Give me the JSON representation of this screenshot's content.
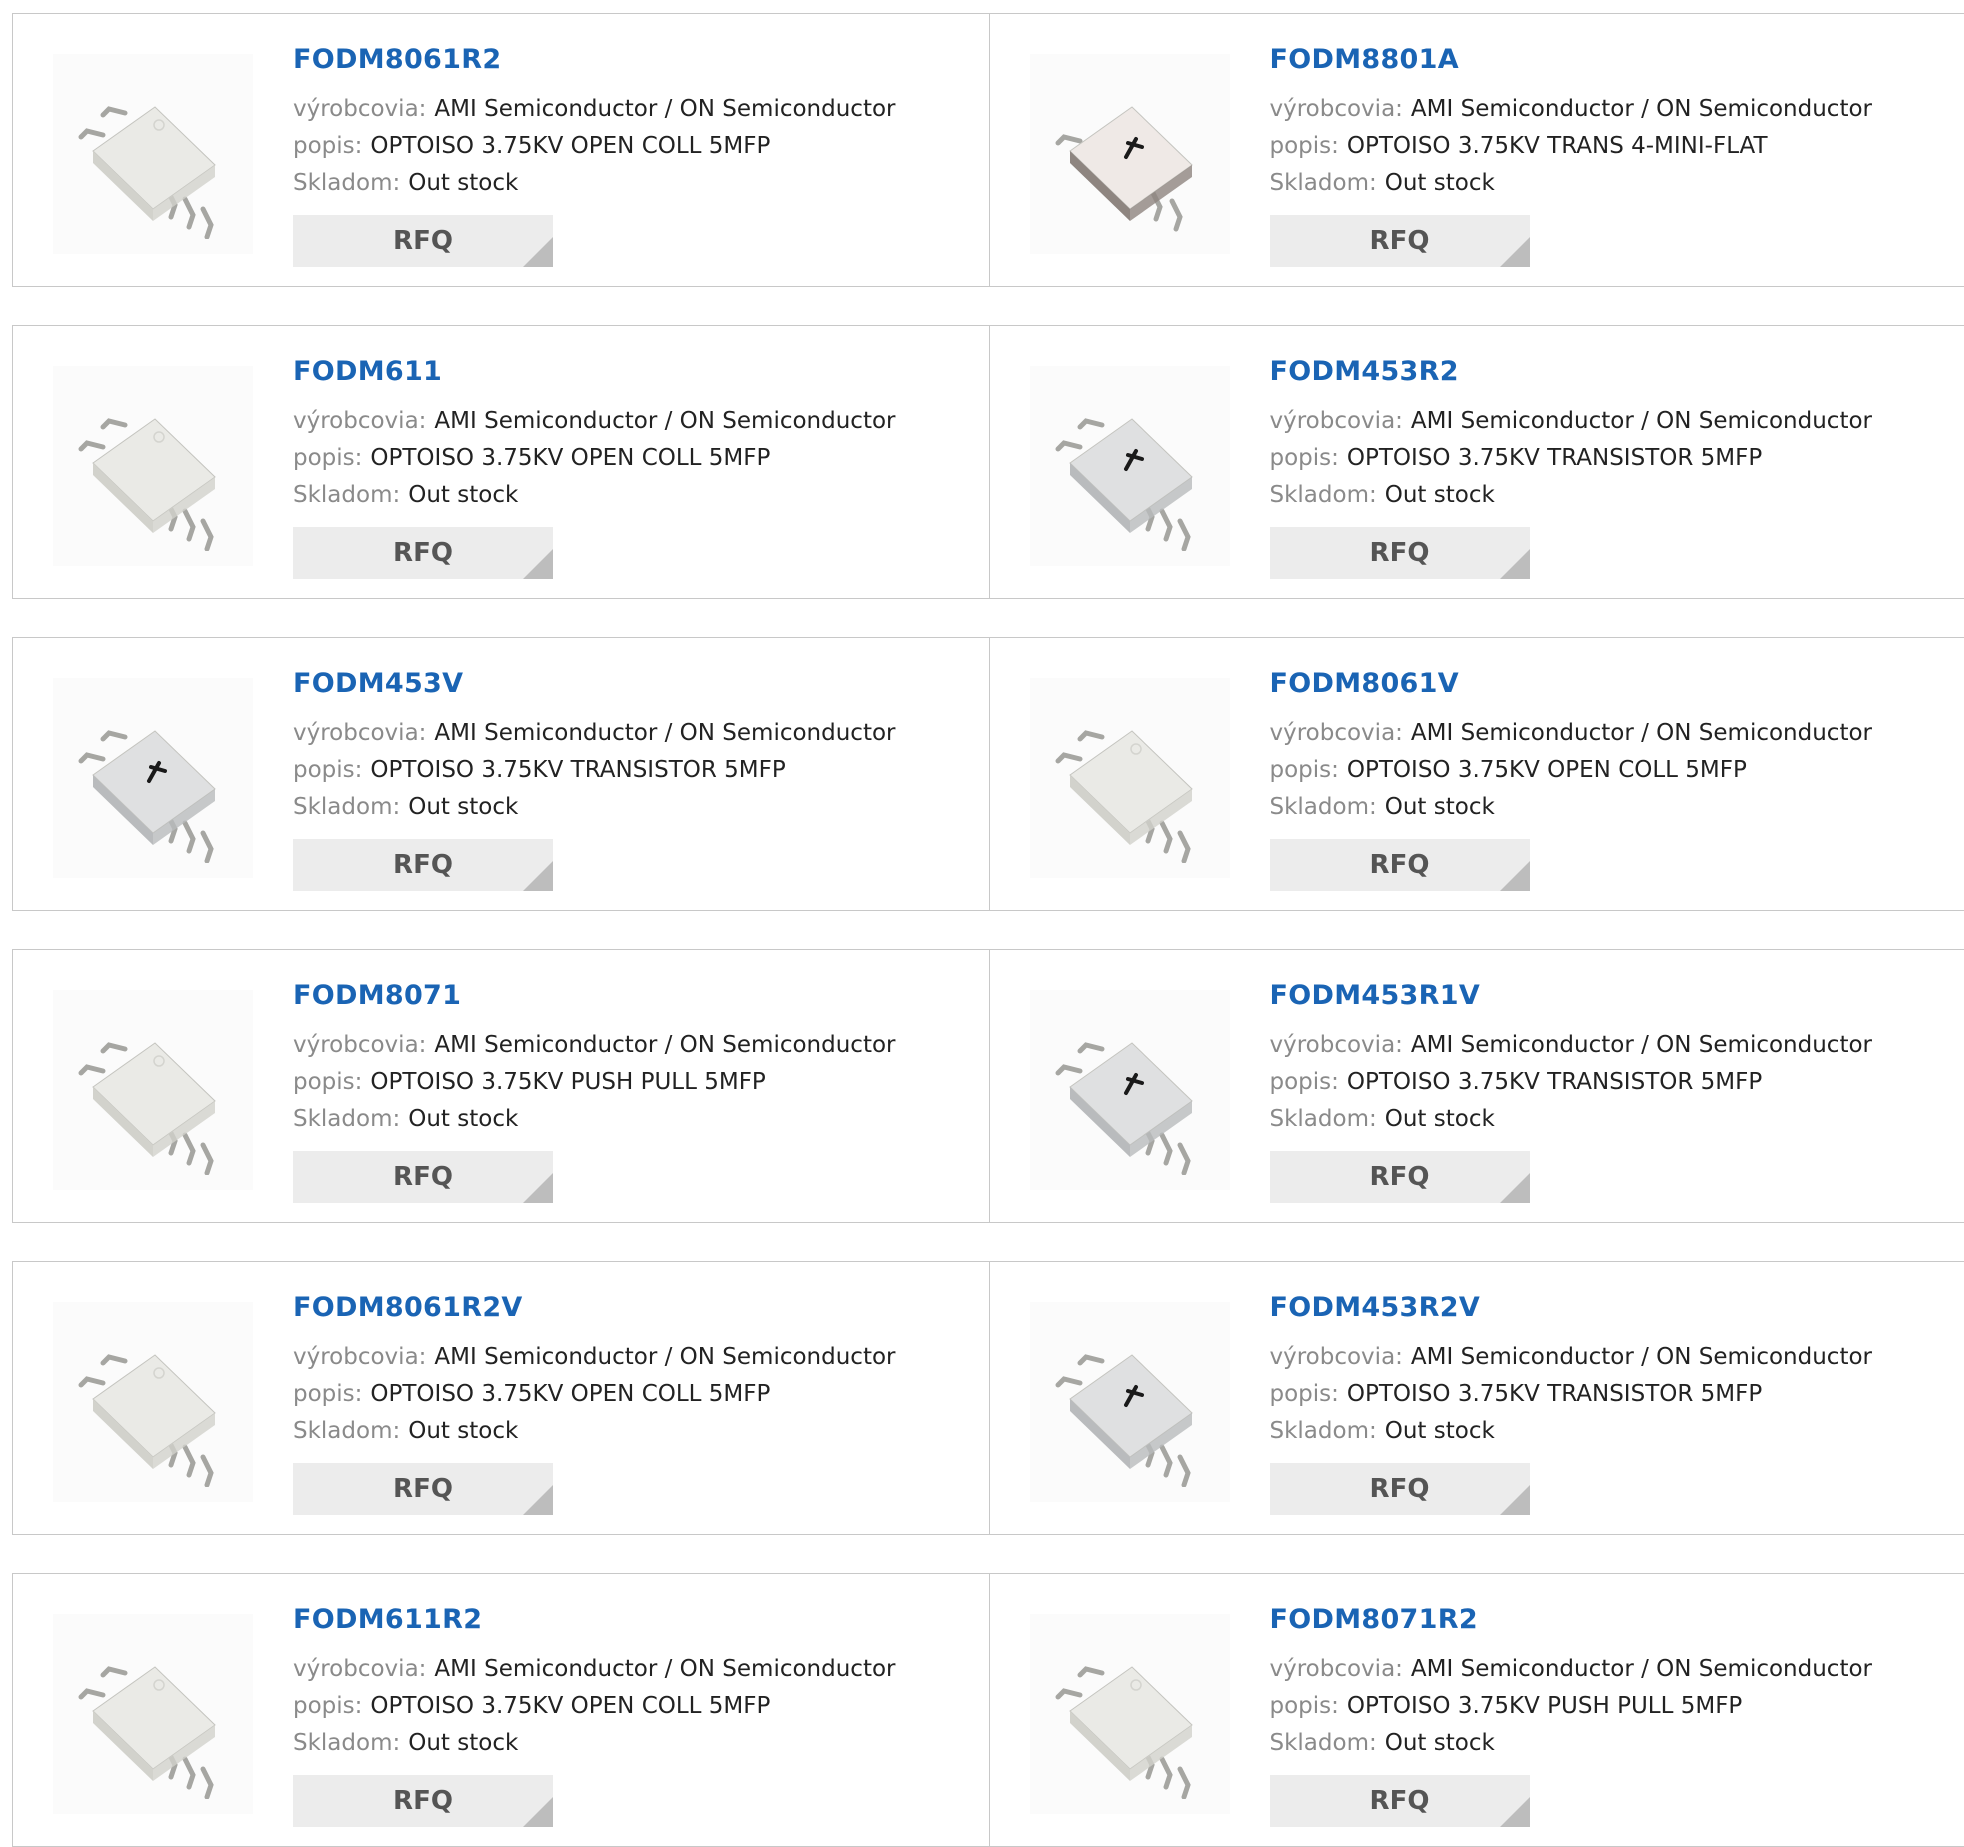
{
  "labels": {
    "manufacturer": "výrobcovia:",
    "description": "popis:",
    "stock": "Skladom:",
    "rfq": "RFQ"
  },
  "colors": {
    "part_link": "#1a64b4",
    "label": "#8a8a8a",
    "value": "#222222",
    "rfq_bg": "#ececec",
    "rfq_text": "#555555",
    "border": "#c8c8c8"
  },
  "products": [
    {
      "part": "FODM8061R2",
      "manufacturer": "AMI Semiconductor / ON Semiconductor",
      "description": "OPTOISO 3.75KV OPEN COLL 5MFP",
      "stock": "Out stock",
      "image": "optocoupler-5pin-icon"
    },
    {
      "part": "FODM8801A",
      "manufacturer": "AMI Semiconductor / ON Semiconductor",
      "description": "OPTOISO 3.75KV TRANS 4-MINI-FLAT",
      "stock": "Out stock",
      "image": "optocoupler-4pin-icon"
    },
    {
      "part": "FODM611",
      "manufacturer": "AMI Semiconductor / ON Semiconductor",
      "description": "OPTOISO 3.75KV OPEN COLL 5MFP",
      "stock": "Out stock",
      "image": "optocoupler-5pin-icon"
    },
    {
      "part": "FODM453R2",
      "manufacturer": "AMI Semiconductor / ON Semiconductor",
      "description": "OPTOISO 3.75KV TRANSISTOR 5MFP",
      "stock": "Out stock",
      "image": "optocoupler-5pin-logo-icon"
    },
    {
      "part": "FODM453V",
      "manufacturer": "AMI Semiconductor / ON Semiconductor",
      "description": "OPTOISO 3.75KV TRANSISTOR 5MFP",
      "stock": "Out stock",
      "image": "optocoupler-5pin-logo-icon"
    },
    {
      "part": "FODM8061V",
      "manufacturer": "AMI Semiconductor / ON Semiconductor",
      "description": "OPTOISO 3.75KV OPEN COLL 5MFP",
      "stock": "Out stock",
      "image": "optocoupler-5pin-icon"
    },
    {
      "part": "FODM8071",
      "manufacturer": "AMI Semiconductor / ON Semiconductor",
      "description": "OPTOISO 3.75KV PUSH PULL 5MFP",
      "stock": "Out stock",
      "image": "optocoupler-5pin-icon"
    },
    {
      "part": "FODM453R1V",
      "manufacturer": "AMI Semiconductor / ON Semiconductor",
      "description": "OPTOISO 3.75KV TRANSISTOR 5MFP",
      "stock": "Out stock",
      "image": "optocoupler-5pin-logo-icon"
    },
    {
      "part": "FODM8061R2V",
      "manufacturer": "AMI Semiconductor / ON Semiconductor",
      "description": "OPTOISO 3.75KV OPEN COLL 5MFP",
      "stock": "Out stock",
      "image": "optocoupler-5pin-icon"
    },
    {
      "part": "FODM453R2V",
      "manufacturer": "AMI Semiconductor / ON Semiconductor",
      "description": "OPTOISO 3.75KV TRANSISTOR 5MFP",
      "stock": "Out stock",
      "image": "optocoupler-5pin-logo-icon"
    },
    {
      "part": "FODM611R2",
      "manufacturer": "AMI Semiconductor / ON Semiconductor",
      "description": "OPTOISO 3.75KV OPEN COLL 5MFP",
      "stock": "Out stock",
      "image": "optocoupler-5pin-icon"
    },
    {
      "part": "FODM8071R2",
      "manufacturer": "AMI Semiconductor / ON Semiconductor",
      "description": "OPTOISO 3.75KV PUSH PULL 5MFP",
      "stock": "Out stock",
      "image": "optocoupler-5pin-icon"
    }
  ]
}
